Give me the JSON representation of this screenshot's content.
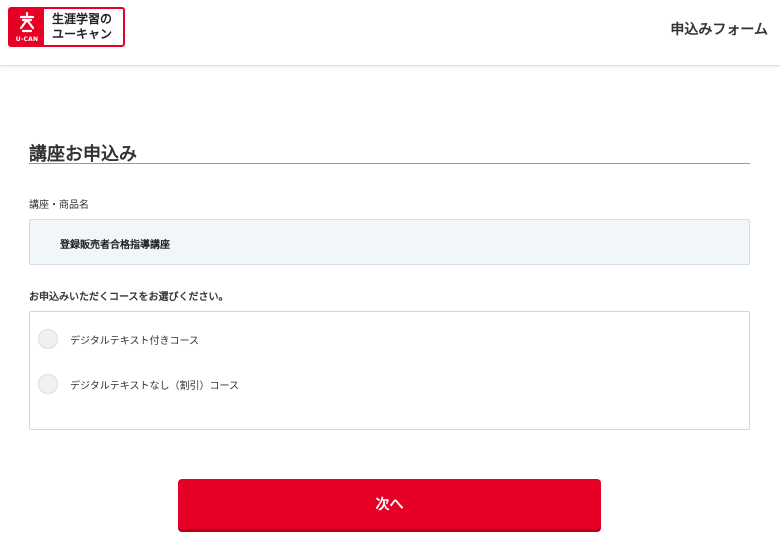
{
  "header": {
    "logo_mark_text": "U-CAN",
    "logo_line1": "生涯学習の",
    "logo_line2": "ユーキャン",
    "title": "申込みフォーム"
  },
  "main": {
    "page_title": "講座お申込み",
    "product_label": "講座・商品名",
    "product_name": "登録販売者合格指導講座",
    "course_prompt": "お申込みいただくコースをお選びください。",
    "course_options": [
      {
        "label": "デジタルテキスト付きコース",
        "selected": false
      },
      {
        "label": "デジタルテキストなし（割引）コース",
        "selected": false
      }
    ],
    "next_button_label": "次へ"
  },
  "colors": {
    "brand_red": "#e60026",
    "product_box_bg": "#f1f6f9"
  },
  "icons": {
    "logo": "ucan-logo-icon",
    "radio": "radio-unchecked-icon"
  }
}
